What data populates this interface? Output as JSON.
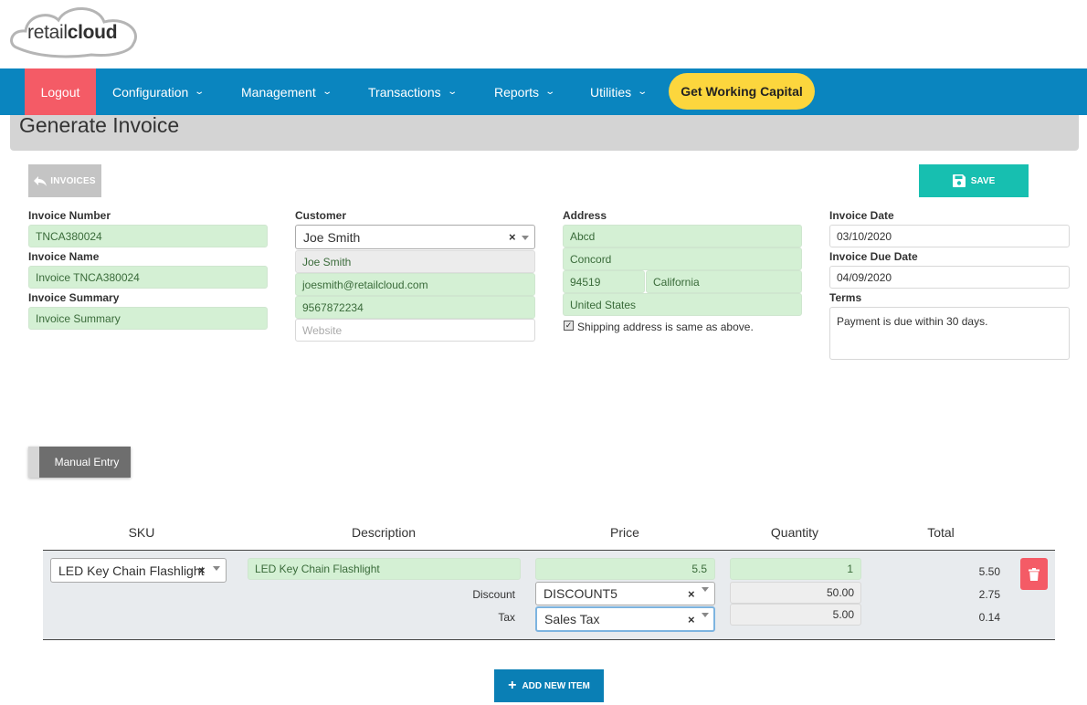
{
  "brand": {
    "logo_light": "retail",
    "logo_bold": "cloud"
  },
  "nav": {
    "logout": "Logout",
    "items": [
      "Configuration",
      "Management",
      "Transactions",
      "Reports",
      "Utilities"
    ],
    "cta": "Get Working Capital"
  },
  "page": {
    "title": "Generate Invoice"
  },
  "actions": {
    "invoices": "INVOICES",
    "save": "SAVE",
    "manual_entry": "Manual Entry",
    "add_item": "ADD NEW ITEM"
  },
  "invoice": {
    "number_label": "Invoice Number",
    "number": "TNCA380024",
    "name_label": "Invoice Name",
    "name": "Invoice TNCA380024",
    "summary_label": "Invoice Summary",
    "summary": "Invoice Summary"
  },
  "customer": {
    "label": "Customer",
    "selected": "Joe Smith",
    "name": "Joe Smith",
    "email": "joesmith@retailcloud.com",
    "phone": "9567872234",
    "website_placeholder": "Website"
  },
  "address": {
    "label": "Address",
    "line1": "Abcd",
    "city": "Concord",
    "zip": "94519",
    "state": "California",
    "country": "United States",
    "shipping_same": "Shipping address is same as above."
  },
  "dates": {
    "invoice_date_label": "Invoice Date",
    "invoice_date": "03/10/2020",
    "due_date_label": "Invoice Due Date",
    "due_date": "04/09/2020",
    "terms_label": "Terms",
    "terms": "Payment is due within 30 days."
  },
  "table": {
    "headers": {
      "sku": "SKU",
      "description": "Description",
      "price": "Price",
      "quantity": "Quantity",
      "total": "Total"
    },
    "item": {
      "sku": "LED Key Chain Flashlight",
      "description": "LED Key Chain Flashlight",
      "price": "5.5",
      "quantity": "1",
      "total": "5.50",
      "discount_label": "Discount",
      "discount_select": "DISCOUNT5",
      "discount_value": "50.00",
      "discount_total": "2.75",
      "tax_label": "Tax",
      "tax_select": "Sales Tax",
      "tax_value": "5.00",
      "tax_total": "0.14"
    }
  },
  "colors": {
    "nav": "#0a85bf",
    "logout": "#f45b66",
    "cta": "#fcd63d",
    "save": "#17bfb0",
    "field_green": "#d4f0d4"
  },
  "icons": {
    "invoices": "reply-arrow-icon",
    "save": "floppy-disk-icon",
    "delete": "trash-icon",
    "add": "plus-icon"
  }
}
